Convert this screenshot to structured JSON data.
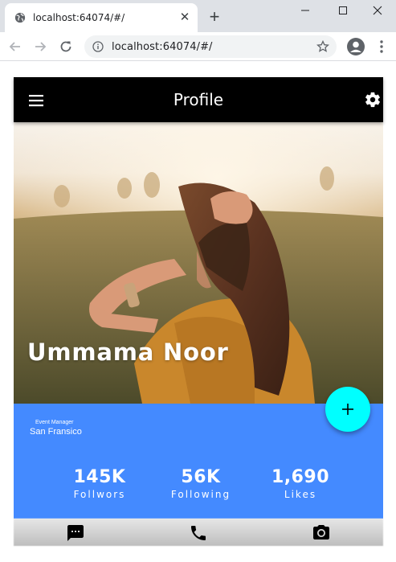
{
  "browser": {
    "tab_title": "localhost:64074/#/",
    "url": "localhost:64074/#/"
  },
  "app": {
    "title": "Profile",
    "profile": {
      "name": "Ummama Noor",
      "job_title": "Event Manager",
      "location": "San Fransico"
    },
    "stats": [
      {
        "value": "145K",
        "label": "Follwors"
      },
      {
        "value": "56K",
        "label": "Following"
      },
      {
        "value": "1,690",
        "label": "Likes"
      }
    ],
    "fab_icon": "plus-icon",
    "bottom_nav": [
      {
        "icon": "message-icon"
      },
      {
        "icon": "phone-icon"
      },
      {
        "icon": "camera-icon"
      }
    ],
    "colors": {
      "appbar": "#000000",
      "info_panel": "#448aff",
      "fab": "#00ffff"
    }
  }
}
